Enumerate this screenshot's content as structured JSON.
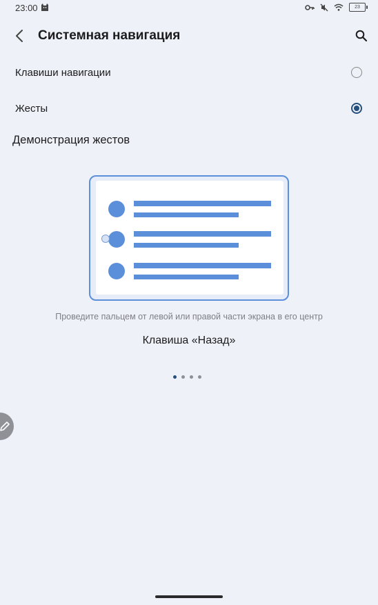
{
  "status_bar": {
    "time": "23:00",
    "battery_level": "23",
    "icons": [
      "cat-notification-icon",
      "vpn-key-icon",
      "mute-icon",
      "wifi-icon",
      "battery-icon"
    ]
  },
  "app_bar": {
    "title": "Системная навигация",
    "back_icon": "chevron-left-icon",
    "search_icon": "search-icon"
  },
  "options": [
    {
      "label": "Клавиши навигации",
      "selected": false
    },
    {
      "label": "Жесты",
      "selected": true
    }
  ],
  "demo": {
    "section_title": "Демонстрация жестов",
    "instruction": "Проведите пальцем от левой или правой части экрана в его центр",
    "gesture_name": "Клавиша «Назад»",
    "page_count": 4,
    "current_page": 1
  },
  "colors": {
    "accent": "#25507e",
    "illustration": "#5b8fd9",
    "background": "#eef1f7"
  },
  "floating_button": {
    "icon": "pencil-icon"
  }
}
